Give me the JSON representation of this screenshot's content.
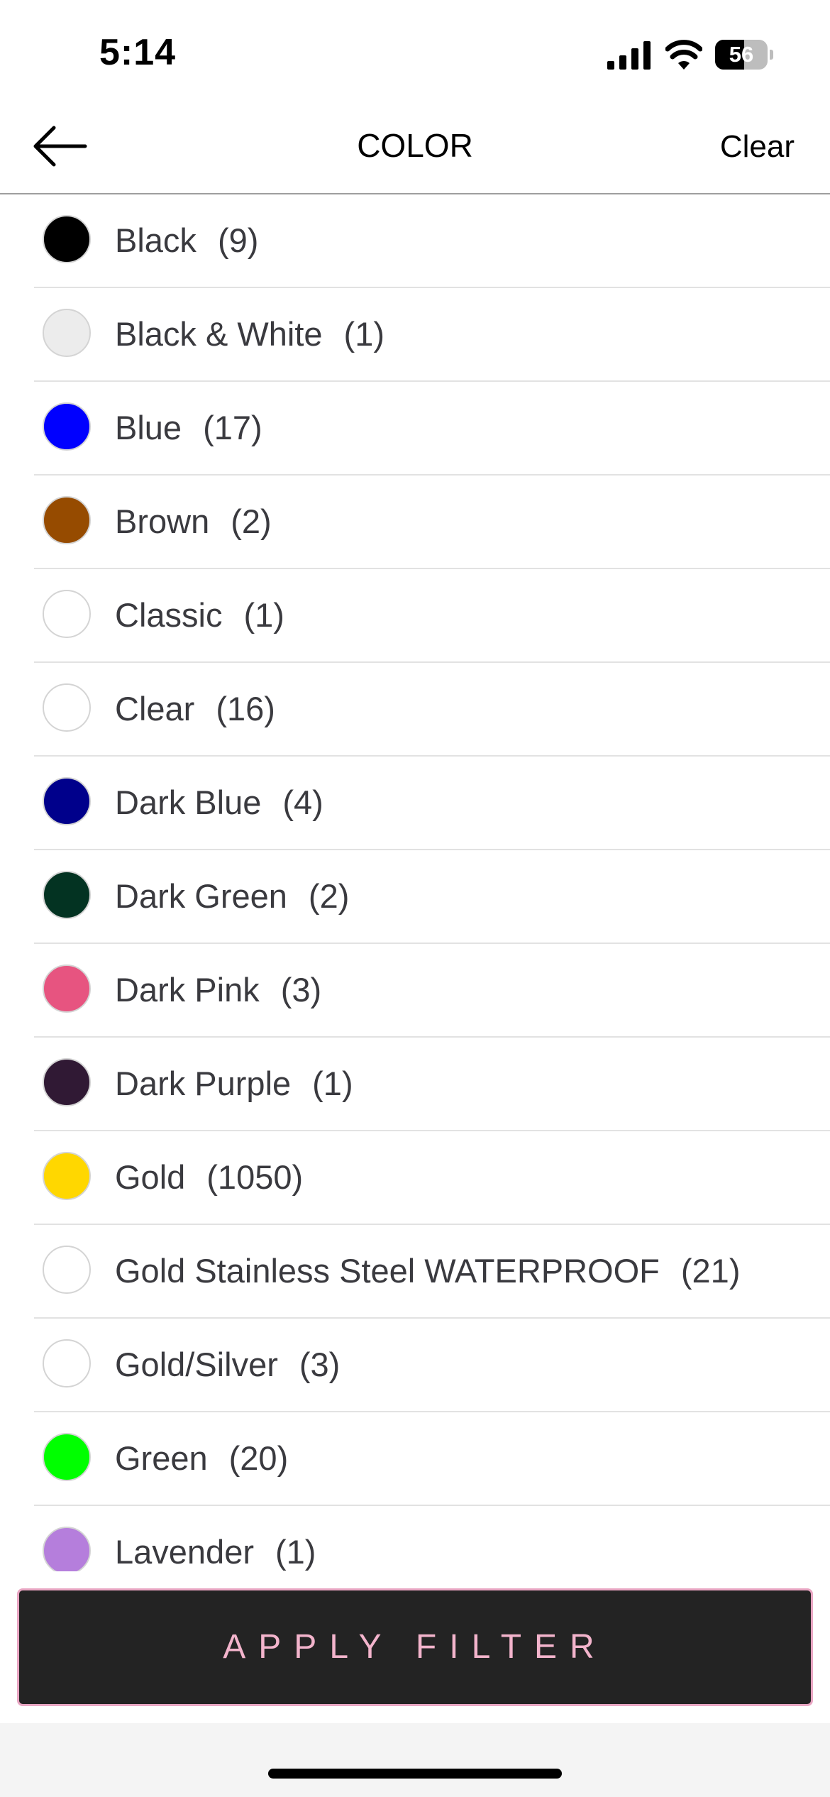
{
  "status_bar": {
    "time": "5:14",
    "battery_percent": "56",
    "battery_level": 0.56
  },
  "header": {
    "title": "COLOR",
    "clear_label": "Clear"
  },
  "colors": [
    {
      "name": "Black",
      "count": "(9)",
      "swatch": "#000000"
    },
    {
      "name": "Black & White",
      "count": "(1)",
      "swatch": "#ececec"
    },
    {
      "name": "Blue",
      "count": "(17)",
      "swatch": "#0000ff"
    },
    {
      "name": "Brown",
      "count": "(2)",
      "swatch": "#964b00"
    },
    {
      "name": "Classic",
      "count": "(1)",
      "swatch": "#ffffff"
    },
    {
      "name": "Clear",
      "count": "(16)",
      "swatch": "#ffffff"
    },
    {
      "name": "Dark Blue",
      "count": "(4)",
      "swatch": "#00008b"
    },
    {
      "name": "Dark Green",
      "count": "(2)",
      "swatch": "#033322"
    },
    {
      "name": "Dark Pink",
      "count": "(3)",
      "swatch": "#e75480"
    },
    {
      "name": "Dark Purple",
      "count": "(1)",
      "swatch": "#301934"
    },
    {
      "name": "Gold",
      "count": "(1050)",
      "swatch": "#ffd700"
    },
    {
      "name": "Gold Stainless Steel WATERPROOF",
      "count": "(21)",
      "swatch": "#ffffff"
    },
    {
      "name": "Gold/Silver",
      "count": "(3)",
      "swatch": "#ffffff"
    },
    {
      "name": "Green",
      "count": "(20)",
      "swatch": "#00ff00"
    },
    {
      "name": "Lavender",
      "count": "(1)",
      "swatch": "#b57edc"
    }
  ],
  "apply_button": {
    "label": "APPLY FILTER"
  },
  "theme": {
    "accent_pink": "#f3b4cc",
    "button_bg": "#232323"
  }
}
